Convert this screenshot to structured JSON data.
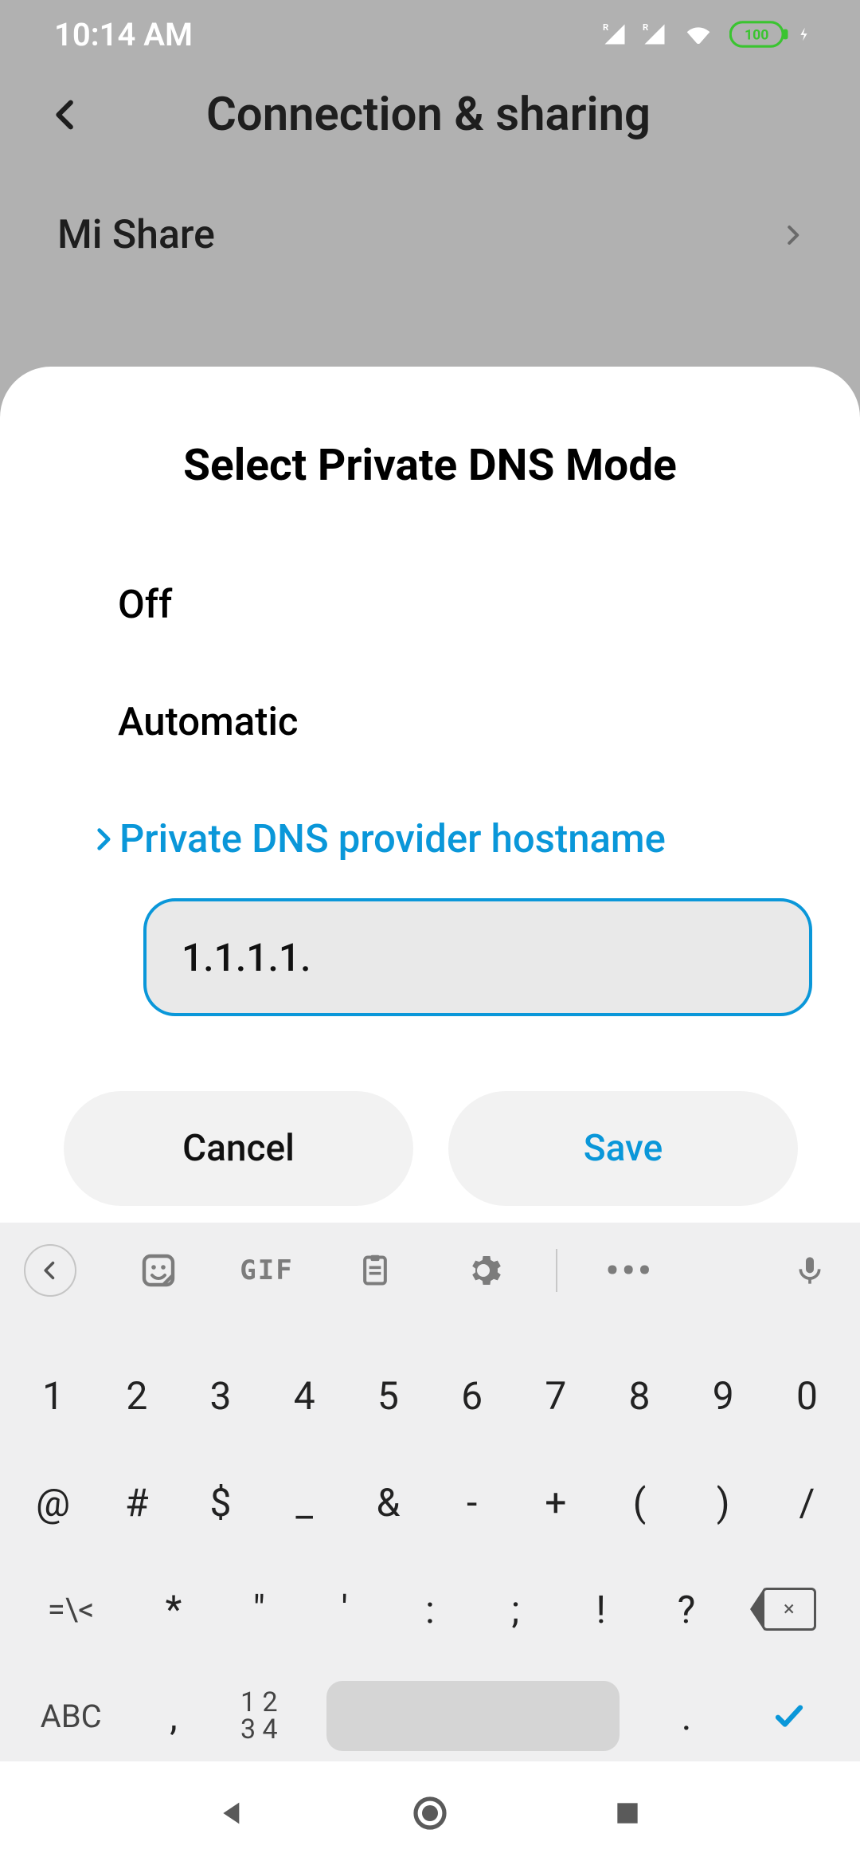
{
  "statusbar": {
    "time": "10:14 AM",
    "battery_level": "100"
  },
  "background_page": {
    "title": "Connection & sharing",
    "row_label": "Mi Share"
  },
  "sheet": {
    "title": "Select Private DNS Mode",
    "options": {
      "off": "Off",
      "automatic": "Automatic",
      "hostname": "Private DNS provider hostname"
    },
    "hostname_value": "1.1.1.1.",
    "buttons": {
      "cancel": "Cancel",
      "save": "Save"
    }
  },
  "keyboard": {
    "toolbar": {
      "gif": "GIF"
    },
    "row1": [
      "1",
      "2",
      "3",
      "4",
      "5",
      "6",
      "7",
      "8",
      "9",
      "0"
    ],
    "row2": [
      "@",
      "#",
      "$",
      "_",
      "&",
      "-",
      "+",
      "(",
      ")",
      "/"
    ],
    "row3": {
      "more": "=\\<",
      "keys": [
        "*",
        "\"",
        "'",
        ":",
        ";",
        "!",
        "?"
      ]
    },
    "row4": {
      "abc": "ABC",
      "comma": ",",
      "num_top": "1 2",
      "num_bottom": "3 4",
      "period": "."
    }
  }
}
